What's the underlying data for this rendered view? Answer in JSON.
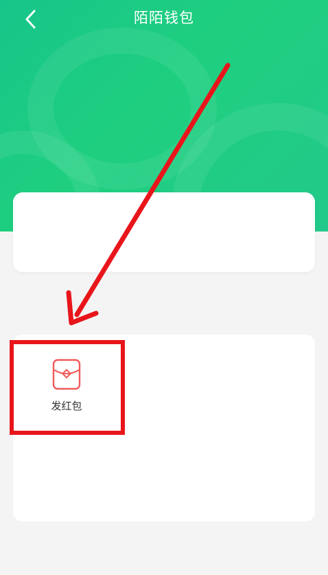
{
  "header": {
    "title": "陌陌钱包",
    "back_icon": "chevron-left-icon"
  },
  "colors": {
    "header_green": "#1fcf7f",
    "page_bg": "#f4f4f4",
    "annotation_red": "#e8151b",
    "icon_red": "#f05a5a"
  },
  "main_card": {
    "items": [
      {
        "label": "发红包",
        "icon": "red-packet-icon"
      }
    ]
  },
  "annotations": {
    "arrow": "red-arrow",
    "highlight": "red-highlight-box"
  }
}
